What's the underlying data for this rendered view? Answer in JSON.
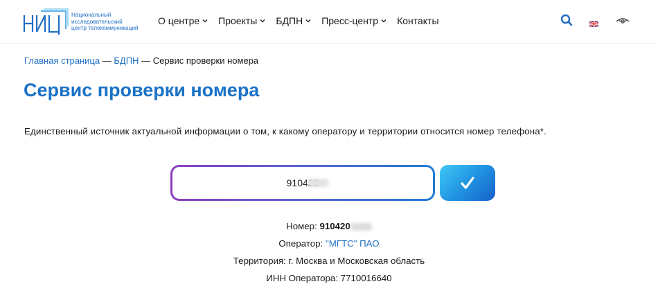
{
  "header": {
    "logo": {
      "mark": "НИЦ",
      "text_lines": [
        "Национальный",
        "исследовательский",
        "центр телекоммуникаций"
      ]
    },
    "nav": [
      {
        "label": "О центре",
        "has_dropdown": true
      },
      {
        "label": "Проекты",
        "has_dropdown": true
      },
      {
        "label": "БДПН",
        "has_dropdown": true
      },
      {
        "label": "Пресс-центр",
        "has_dropdown": true
      },
      {
        "label": "Контакты",
        "has_dropdown": false
      }
    ],
    "icons": {
      "search": "search-icon",
      "language": "uk-flag-icon",
      "accessibility": "eye-icon"
    }
  },
  "breadcrumb": {
    "home": "Главная страница",
    "section": "БДПН",
    "separator": "—",
    "current": "Сервис проверки номера"
  },
  "page": {
    "title": "Сервис проверки номера",
    "intro": "Единственный источник актуальной информации о том, к какому оператору и территории относится номер телефона*."
  },
  "form": {
    "phone_value": "910420",
    "submit_icon": "checkmark-icon"
  },
  "result": {
    "number_label": "Номер:",
    "number_value": "910420",
    "operator_label": "Оператор:",
    "operator_value": "\"МГТС\" ПАО",
    "territory_label": "Территория:",
    "territory_value": "г. Москва и Московская область",
    "inn_label": "ИНН Оператора:",
    "inn_value": "7710016640"
  },
  "colors": {
    "brand_blue": "#1a72c7",
    "link_blue": "#1f6fc5",
    "field_gradient": [
      "#8b3cc0",
      "#1f7ad6"
    ],
    "button_gradient": [
      "#3fc8f5",
      "#1760c8"
    ]
  }
}
